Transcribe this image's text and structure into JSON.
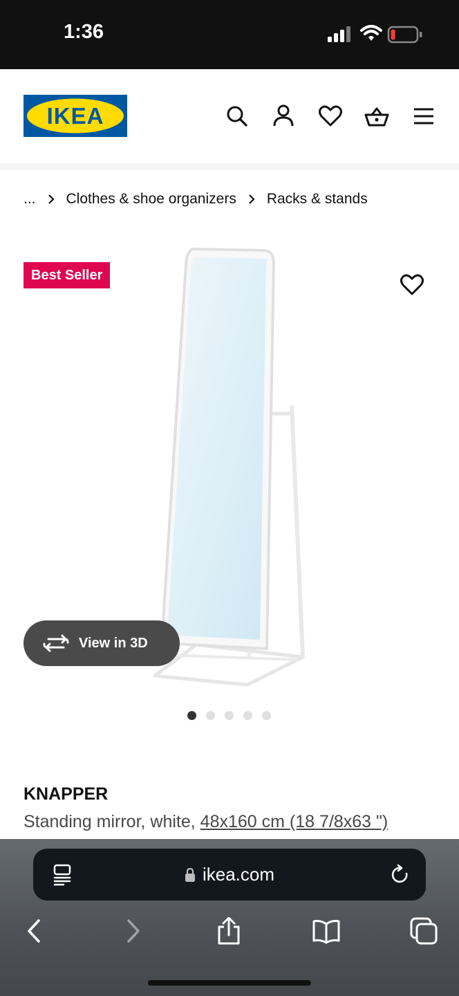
{
  "status_bar": {
    "time": "1:36",
    "icons": [
      "signal-icon",
      "wifi-icon",
      "battery-icon"
    ],
    "battery_color": "#ff3b30"
  },
  "header": {
    "logo_text": "IKEA",
    "logo_colors": {
      "blue": "#0058a3",
      "yellow": "#ffdb00"
    },
    "icons": [
      "search-icon",
      "account-icon",
      "heart-icon",
      "cart-icon",
      "menu-icon"
    ]
  },
  "breadcrumb": {
    "items": [
      "...",
      "Clothes & shoe organizers",
      "Racks & stands"
    ]
  },
  "product_media": {
    "badge": "Best Seller",
    "badge_color": "#e00751",
    "view_3d_label": "View in 3D",
    "image_count": 5,
    "active_image": 1
  },
  "product": {
    "name": "KNAPPER",
    "description": "Standing mirror, white,",
    "size": "48x160 cm (18 7/8x63 \")"
  },
  "browser": {
    "url": "ikea.com",
    "toolbar_icons": [
      "back-icon",
      "forward-icon",
      "share-icon",
      "bookmarks-icon",
      "tabs-icon"
    ]
  }
}
